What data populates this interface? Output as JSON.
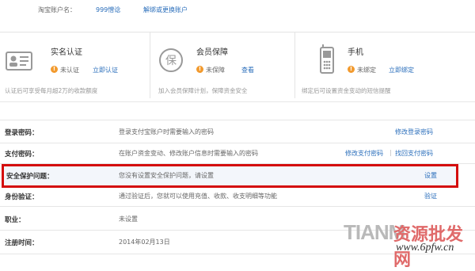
{
  "account": {
    "label": "淘宝账户名：",
    "value": "999憎谂",
    "unbind": "解绑或更换账户"
  },
  "cards": [
    {
      "title": "实名认证",
      "status": "未认证",
      "action": "立即认证",
      "desc": "认证后可享受每月超2万的收款额度",
      "icon": "id-card-icon"
    },
    {
      "title": "会员保障",
      "status": "未保障",
      "action": "查看",
      "desc": "加入会员保障计划，保障资金安全",
      "icon": "shield-badge-icon",
      "icon_text": "保"
    },
    {
      "title": "手机",
      "status": "未绑定",
      "action": "立即绑定",
      "desc": "绑定后可设置资金变动的短信提醒",
      "icon": "phone-icon"
    }
  ],
  "rows": {
    "login_password": {
      "key": "登录密码：",
      "value": "登录支付宝账户时需要输入的密码",
      "action": "修改登录密码"
    },
    "pay_password": {
      "key": "支付密码：",
      "value": "在账户资金变动、修改账户信息时需要输入的密码",
      "action1": "修改支付密码",
      "divider": "|",
      "action2": "找回支付密码"
    },
    "security_question": {
      "key": "安全保护问题：",
      "value": "您没有设置安全保护问题，请设置",
      "action": "设置"
    },
    "identity": {
      "key": "身份验证：",
      "value": "通过验证后，您就可以使用充值、收款、收支明细等功能",
      "action": "验证"
    },
    "job": {
      "key": "职业：",
      "value": "未设置"
    },
    "register": {
      "key": "注册时间：",
      "value": "2014年02月13日"
    }
  },
  "watermark": {
    "brand": "TIANM",
    "cn": "资源批发网",
    "url": "www.6pfw.cn"
  },
  "colors": {
    "link": "#2a6ebb",
    "highlight_border": "#d40c0c",
    "warn": "#f29a2e"
  }
}
